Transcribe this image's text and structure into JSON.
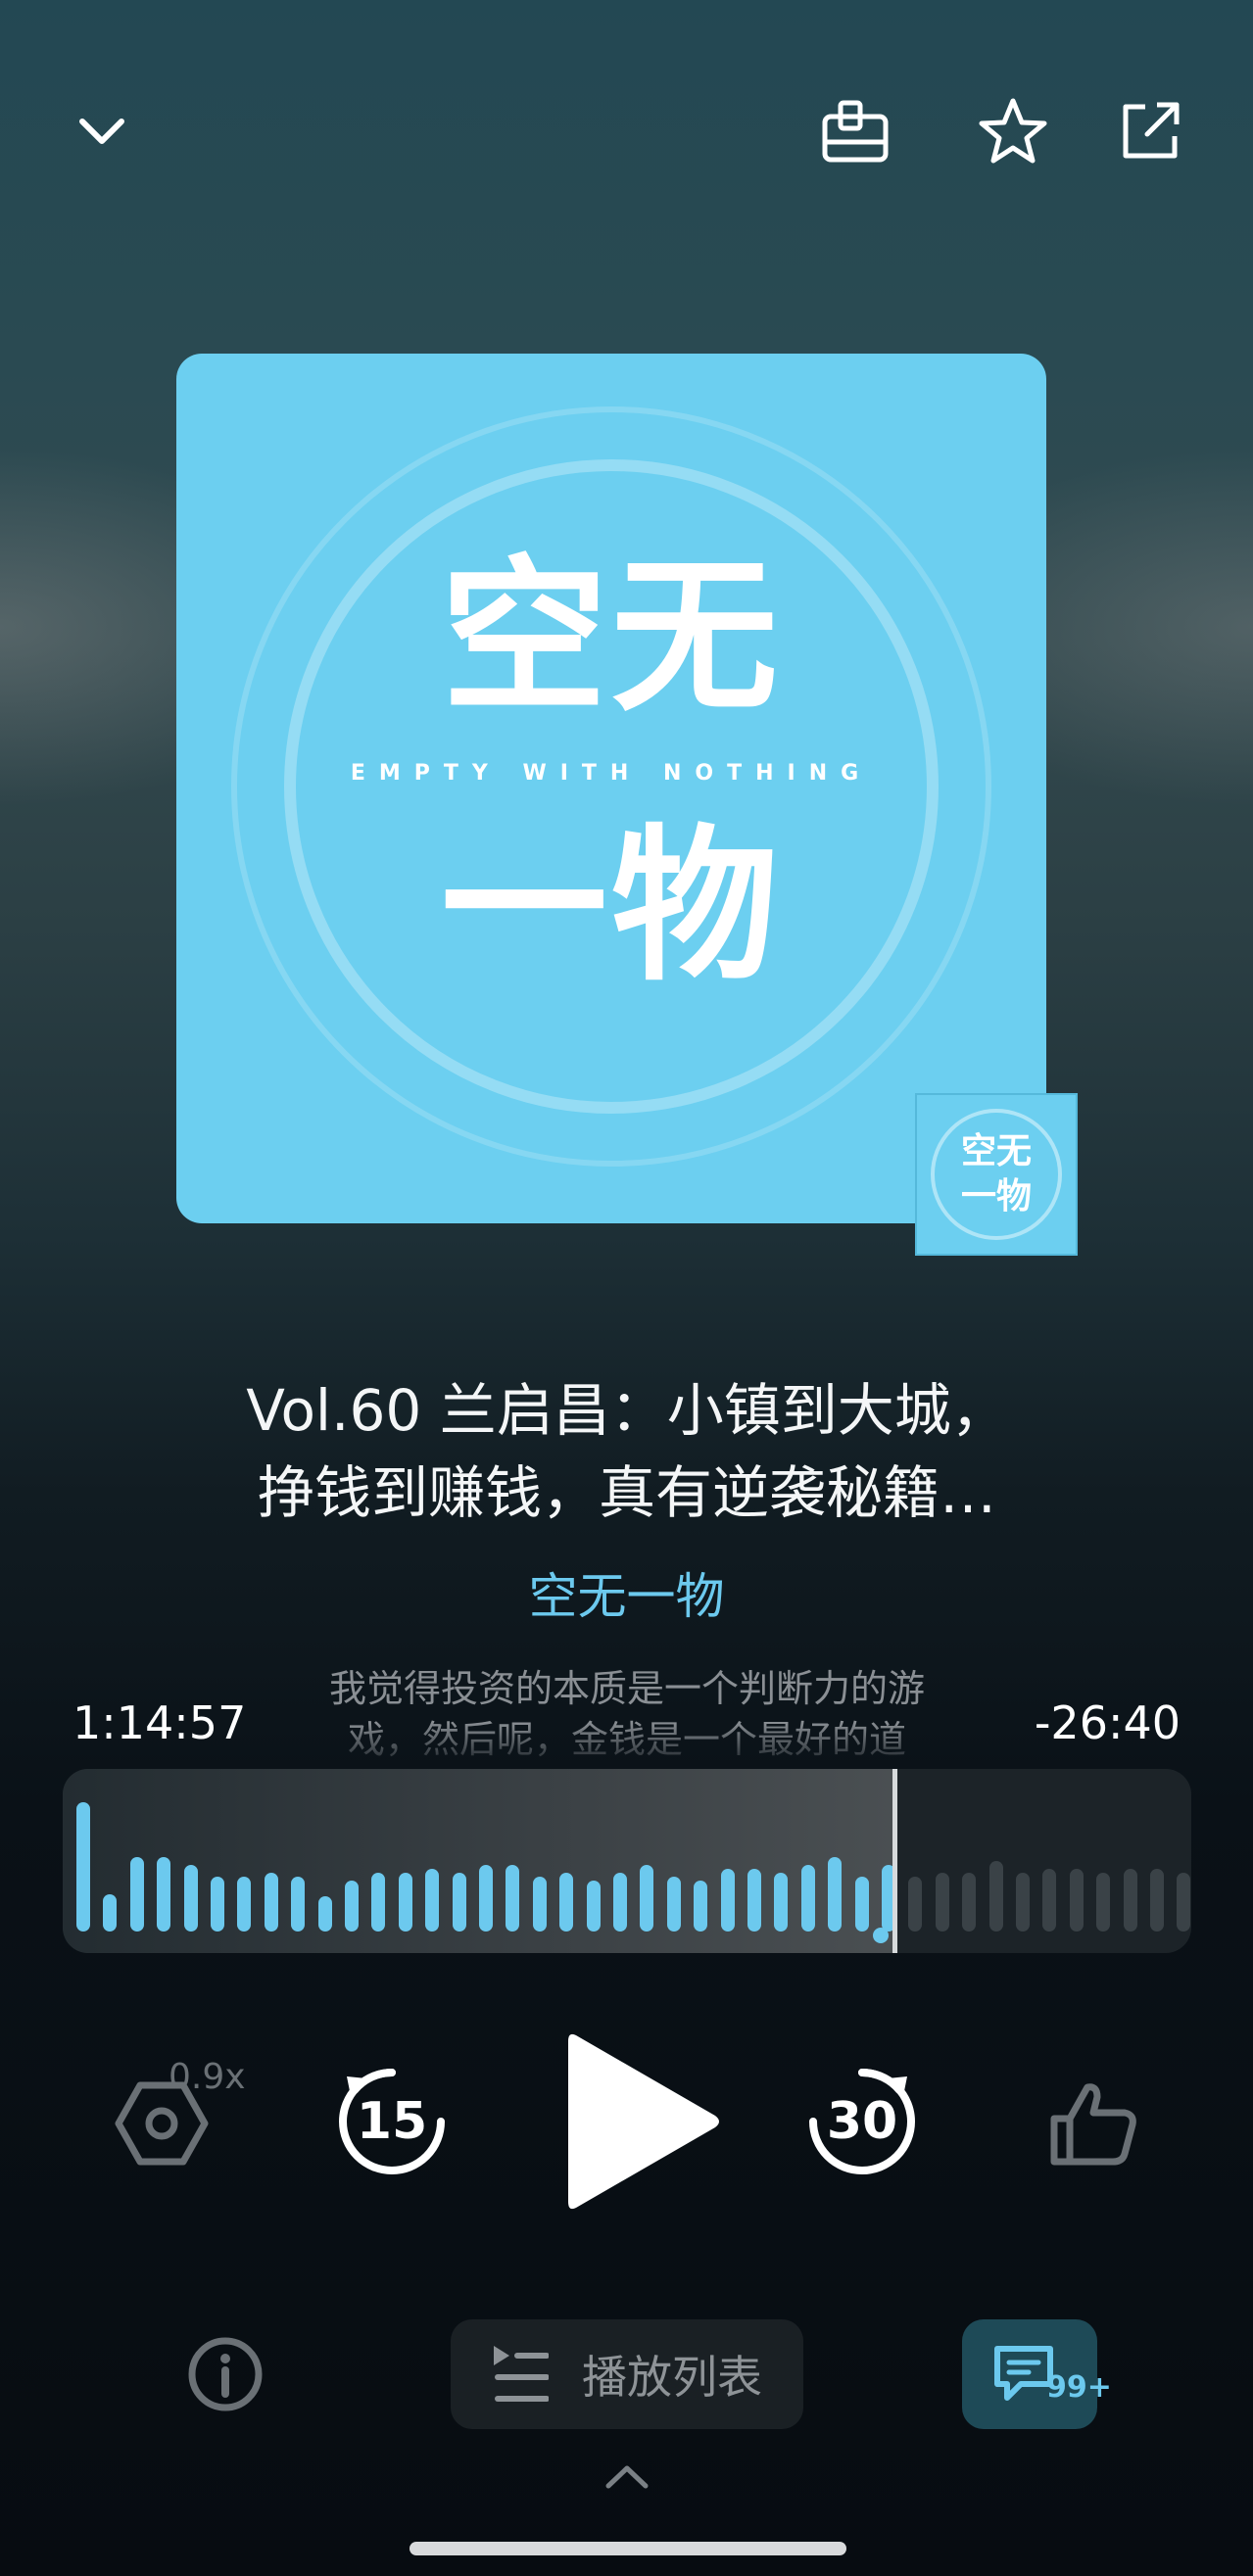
{
  "header": {
    "icons": [
      "chevron-down-icon",
      "add-to-shelf-icon",
      "star-icon",
      "share-icon"
    ]
  },
  "cover": {
    "title_line1": "空无",
    "title_line2": "一物",
    "subtitle": "EMPTY WITH NOTHING",
    "mini_line1": "空无",
    "mini_line2": "一物",
    "color": "#6ccff0"
  },
  "episode": {
    "title_line1": "Vol.60 兰启昌：小镇到大城，",
    "title_line2": "挣钱到赚钱，真有逆袭秘籍…",
    "podcast": "空无一物"
  },
  "lyric": {
    "line1": "我觉得投资的本质是一个判断力的游",
    "line2": "戏，然后呢，金钱是一个最好的道"
  },
  "progress": {
    "elapsed": "1:14:57",
    "remaining": "-26:40",
    "played_fraction": 0.735,
    "accent": "#6cc9ee"
  },
  "controls": {
    "speed": "0.9x",
    "rewind_seconds": "15",
    "forward_seconds": "30",
    "icons": [
      "speed-icon",
      "rewind-15-icon",
      "play-icon",
      "forward-30-icon",
      "thumbs-up-icon"
    ]
  },
  "bottom": {
    "playlist_label": "播放列表",
    "comment_badge": "99+",
    "icons": [
      "info-icon",
      "playlist-icon",
      "comment-icon",
      "chevron-up-icon"
    ]
  }
}
